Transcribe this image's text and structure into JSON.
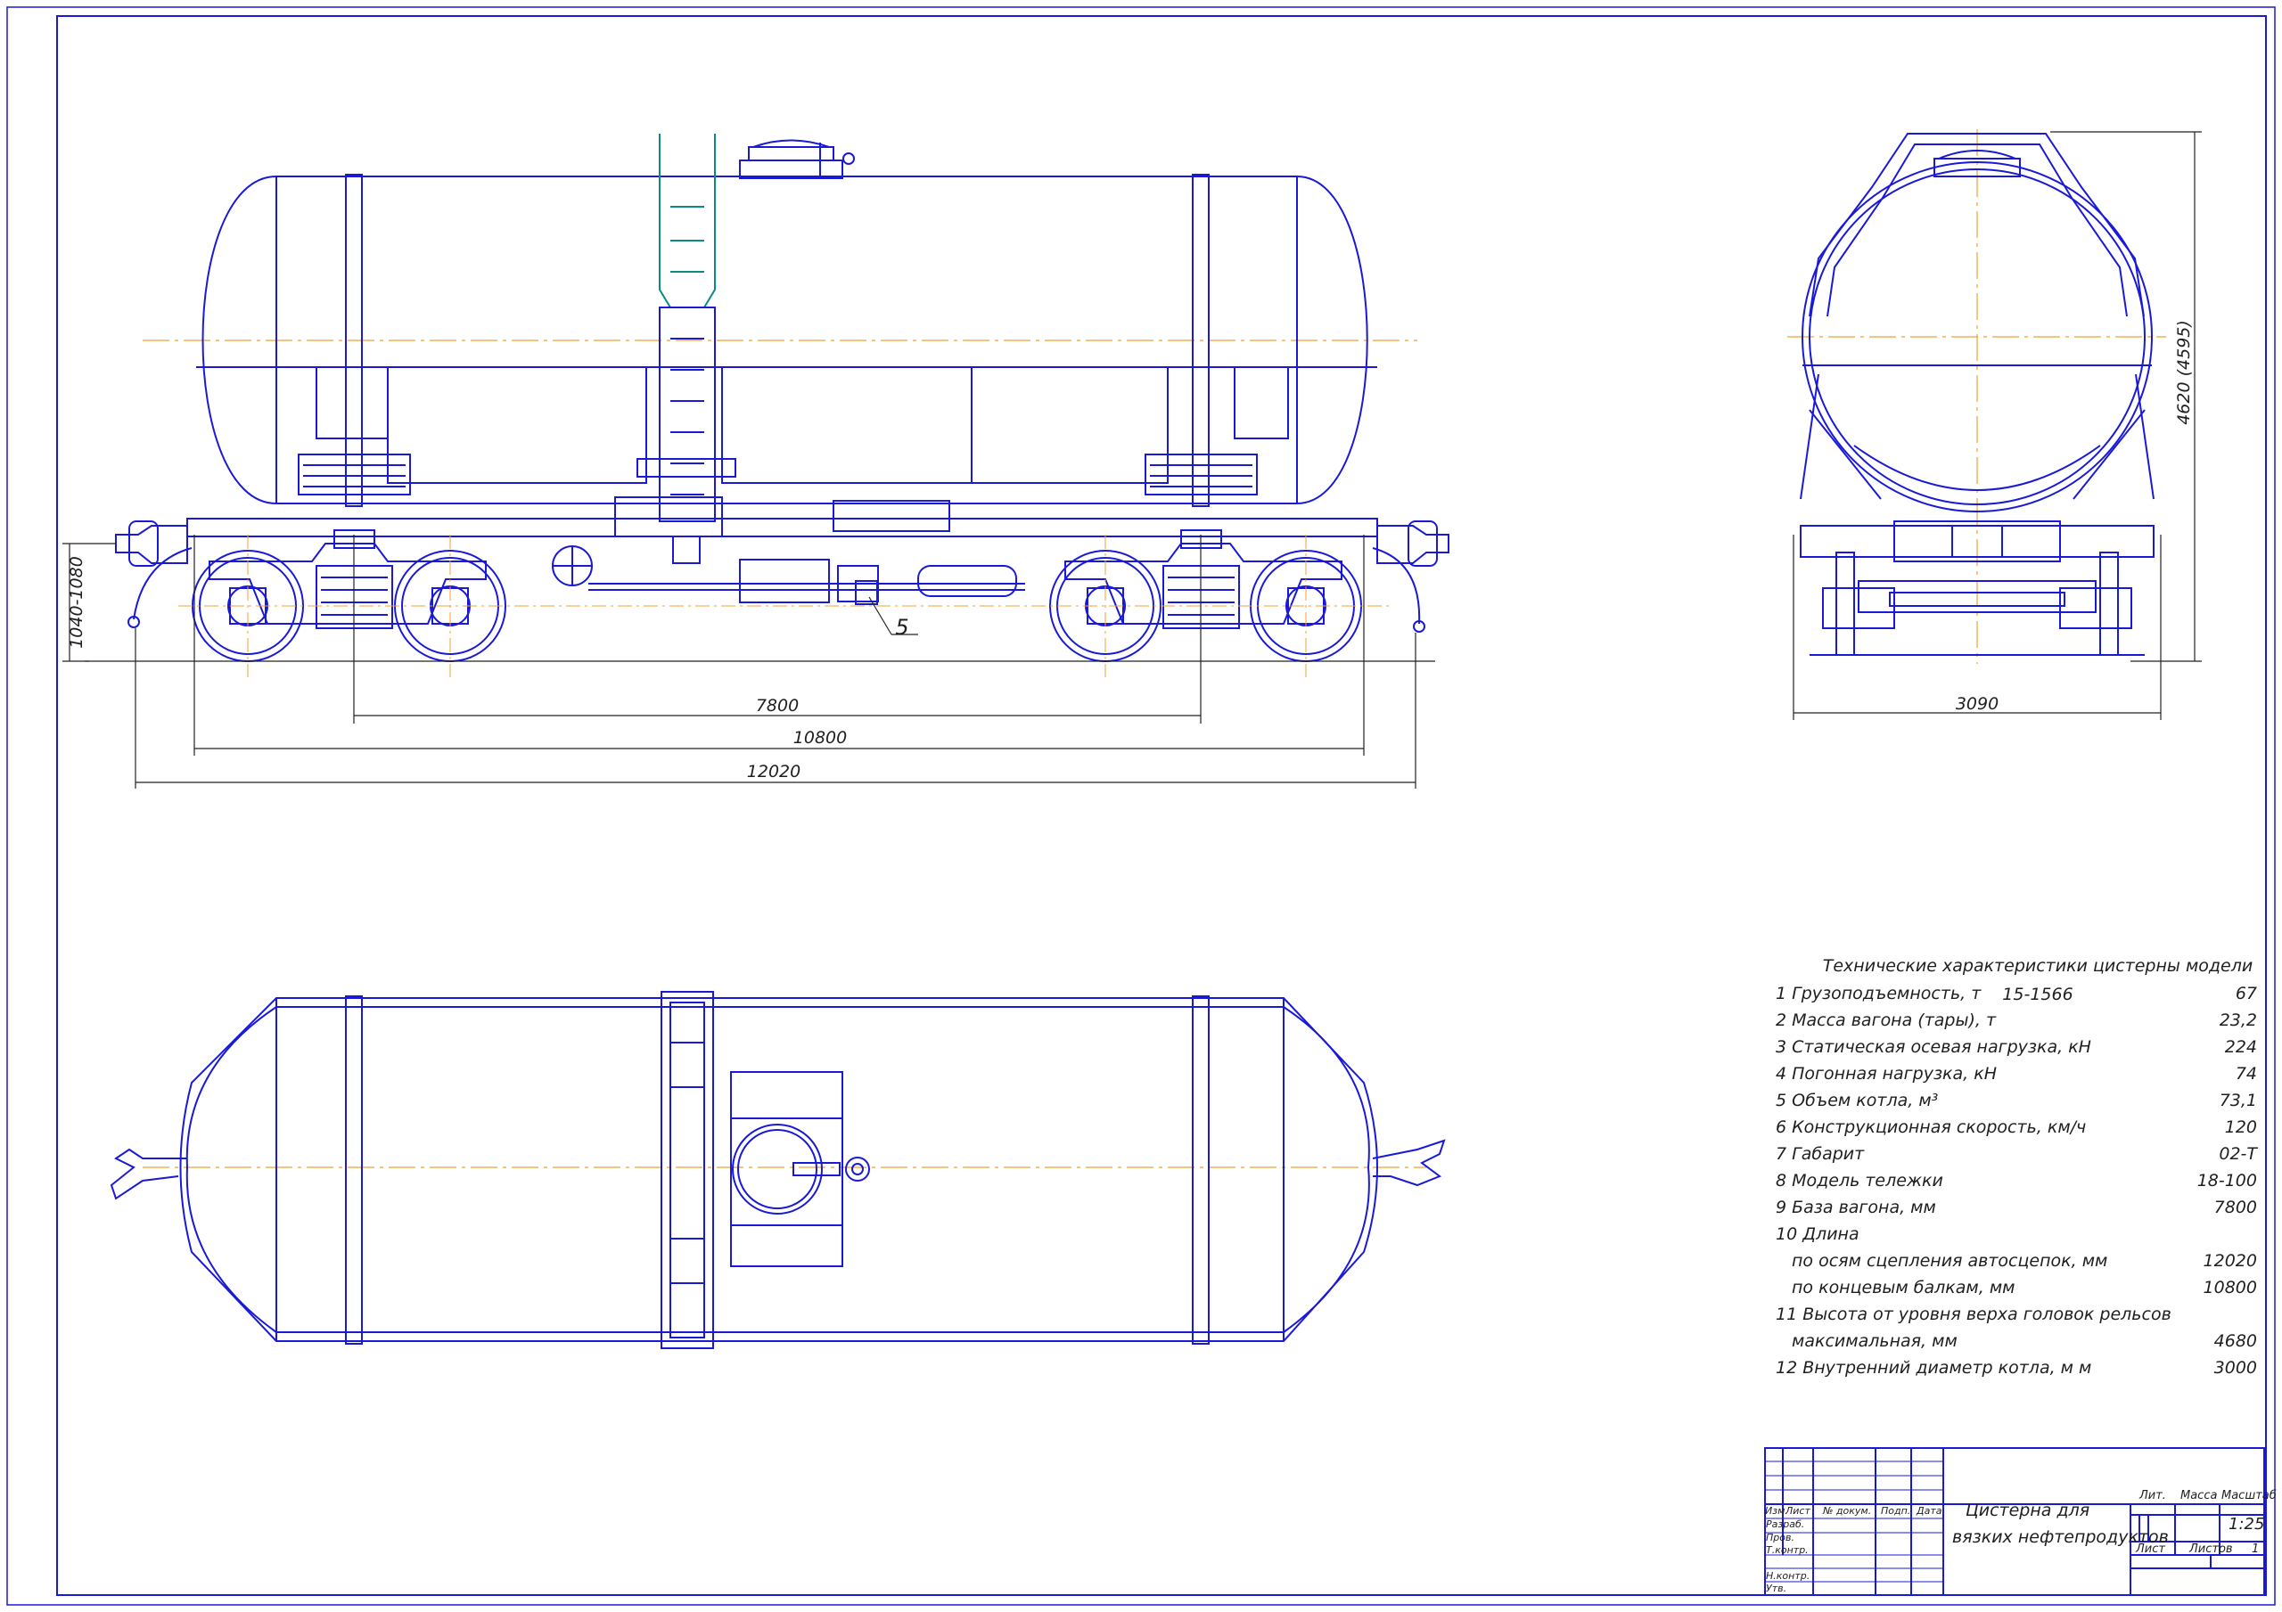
{
  "colors": {
    "line": "#1a1ad6",
    "axis": "#f0a030",
    "dim": "#222222",
    "ladder_top": "#0a8a80"
  },
  "dimensions": {
    "base": "7800",
    "frame_length": "10800",
    "coupler_length": "12020",
    "coupler_height": "1040-1080",
    "height": "4620 (4595)",
    "width": "3090",
    "callout": "5"
  },
  "specs": {
    "title": "Технические характеристики цистерны модели 15-1566",
    "rows": [
      {
        "label": "1 Грузоподъемность, т",
        "value": "67"
      },
      {
        "label": "2 Масса вагона (тары), т",
        "value": "23,2"
      },
      {
        "label": "3 Статическая осевая нагрузка, кН",
        "value": "224"
      },
      {
        "label": "4 Погонная нагрузка, кН",
        "value": "74"
      },
      {
        "label": "5 Объем котла, м³",
        "value": "73,1"
      },
      {
        "label": "6 Конструкционная скорость, км/ч",
        "value": "120"
      },
      {
        "label": "7 Габарит",
        "value": "02-Т"
      },
      {
        "label": "8 Модель тележки",
        "value": "18-100"
      },
      {
        "label": "9 База вагона, мм",
        "value": "7800"
      },
      {
        "label": "10 Длина",
        "value": ""
      },
      {
        "label": "по осям сцепления автосцепок, мм",
        "value": "12020",
        "indent": true
      },
      {
        "label": "по концевым балкам, мм",
        "value": "10800",
        "indent": true
      },
      {
        "label": "11 Высота от уровня верха головок рельсов",
        "value": ""
      },
      {
        "label": "максимальная, мм",
        "value": "4680",
        "indent": true
      },
      {
        "label": "12 Внутренний диаметр котла, м м",
        "value": "3000"
      }
    ]
  },
  "title_block": {
    "name_line1": "Цистерна для",
    "name_line2": "вязких нефтепродуктов",
    "col_izm": "Изм.",
    "col_list": "Лист",
    "col_doc": "№ докум.",
    "col_sign": "Подп.",
    "col_date": "Дата",
    "row_razrab": "Разраб.",
    "row_prov": "Пров.",
    "row_tkontr": "Т.контр.",
    "row_nkontr": "Н.контр.",
    "row_utv": "Утв.",
    "lit": "Лит.",
    "massa": "Масса",
    "masshtab": "Масштаб",
    "scale_value": "1:25",
    "sheet": "Лист",
    "sheets": "Листов",
    "sheets_value": "1"
  }
}
